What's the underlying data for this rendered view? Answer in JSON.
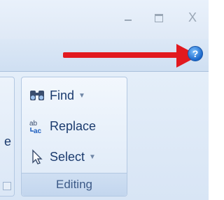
{
  "window": {
    "minimize_icon": "minimize-icon",
    "maximize_icon": "maximize-icon",
    "close_icon": "close-icon",
    "close_glyph": "X"
  },
  "annotation": {
    "arrow_color": "#e2191f",
    "target": "help-button"
  },
  "ribbon": {
    "help": {
      "icon": "help-icon",
      "glyph": "?"
    },
    "left_group_partial": {
      "text": "e"
    },
    "editing_group": {
      "label": "Editing",
      "commands": [
        {
          "label": "Find",
          "icon": "binoculars-icon",
          "has_dropdown": true
        },
        {
          "label": "Replace",
          "icon": "replace-icon",
          "has_dropdown": false
        },
        {
          "label": "Select",
          "icon": "cursor-select-icon",
          "has_dropdown": true
        }
      ]
    }
  }
}
